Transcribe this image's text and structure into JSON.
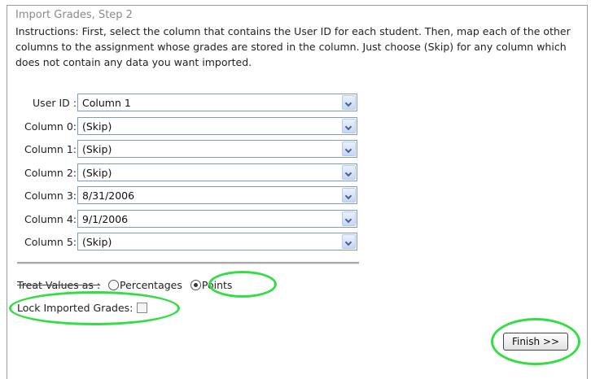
{
  "page": {
    "title": "Import Grades, Step 2",
    "instructions": "Instructions: First, select the column that contains the User ID for each student. Then, map each of the other columns to the assignment whose grades are stored in the column. Just choose (Skip) for any column which does not contain any data you want imported."
  },
  "mappings": [
    {
      "label": "User ID :",
      "value": "Column 1"
    },
    {
      "label": "Column 0:",
      "value": "(Skip)"
    },
    {
      "label": "Column 1:",
      "value": "(Skip)"
    },
    {
      "label": "Column 2:",
      "value": "(Skip)"
    },
    {
      "label": "Column 3:",
      "value": "8/31/2006"
    },
    {
      "label": "Column 4:",
      "value": "9/1/2006"
    },
    {
      "label": "Column 5:",
      "value": "(Skip)"
    }
  ],
  "treat_values": {
    "label": "Treat Values as :",
    "options": [
      "Percentages",
      "Points"
    ],
    "selected": "Points"
  },
  "lock": {
    "label": "Lock Imported Grades:",
    "checked": false
  },
  "finish_label": "Finish >>",
  "colors": {
    "annotation": "#33dd44",
    "select_border": "#7f9db9"
  }
}
